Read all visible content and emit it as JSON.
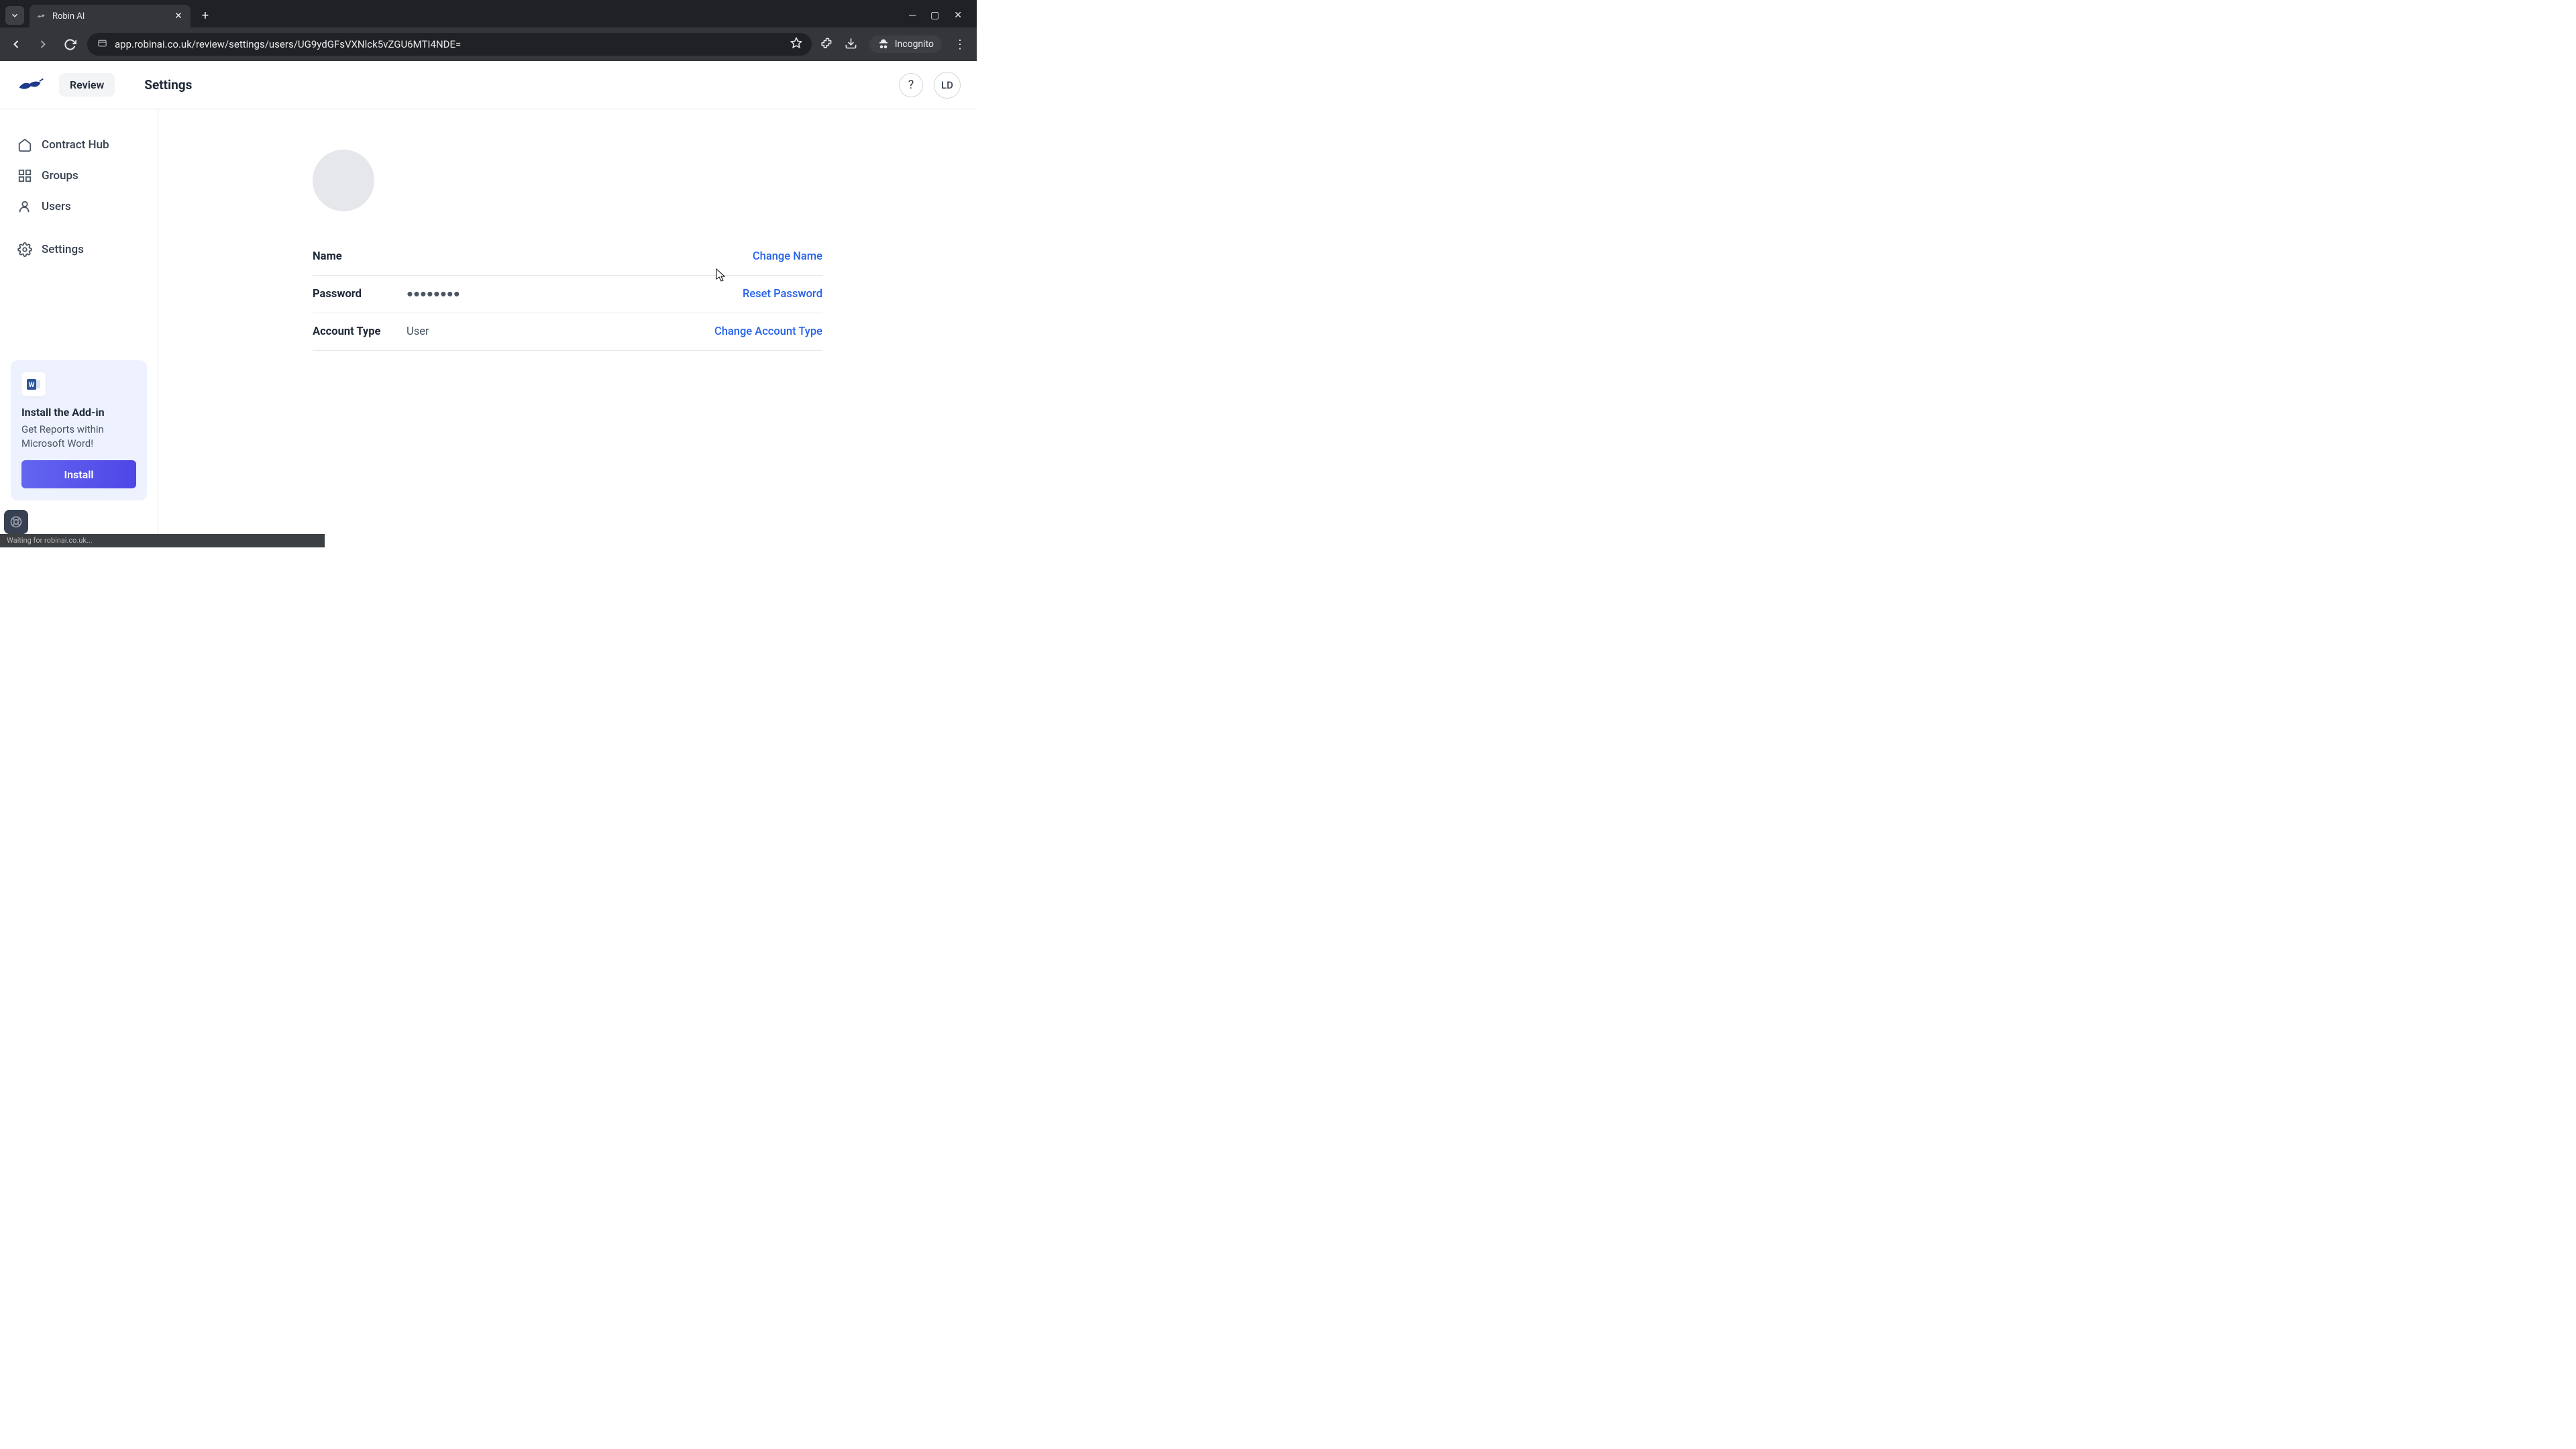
{
  "browser": {
    "tab_title": "Robin AI",
    "url": "app.robinai.co.uk/review/settings/users/UG9ydGFsVXNlck5vZGU6MTI4NDE=",
    "incognito_label": "Incognito"
  },
  "header": {
    "review_label": "Review",
    "page_title": "Settings",
    "avatar_initials": "LD"
  },
  "sidebar": {
    "items": [
      {
        "label": "Contract Hub"
      },
      {
        "label": "Groups"
      },
      {
        "label": "Users"
      },
      {
        "label": "Settings"
      }
    ],
    "promo": {
      "title": "Install the Add-in",
      "body": "Get Reports within Microsoft Word!",
      "button": "Install"
    }
  },
  "profile": {
    "rows": [
      {
        "label": "Name",
        "value": "",
        "action": "Change Name"
      },
      {
        "label": "Password",
        "value": "●●●●●●●●",
        "action": "Reset Password"
      },
      {
        "label": "Account Type",
        "value": "User",
        "action": "Change Account Type"
      }
    ]
  },
  "status_bar": "Waiting for robinai.co.uk..."
}
